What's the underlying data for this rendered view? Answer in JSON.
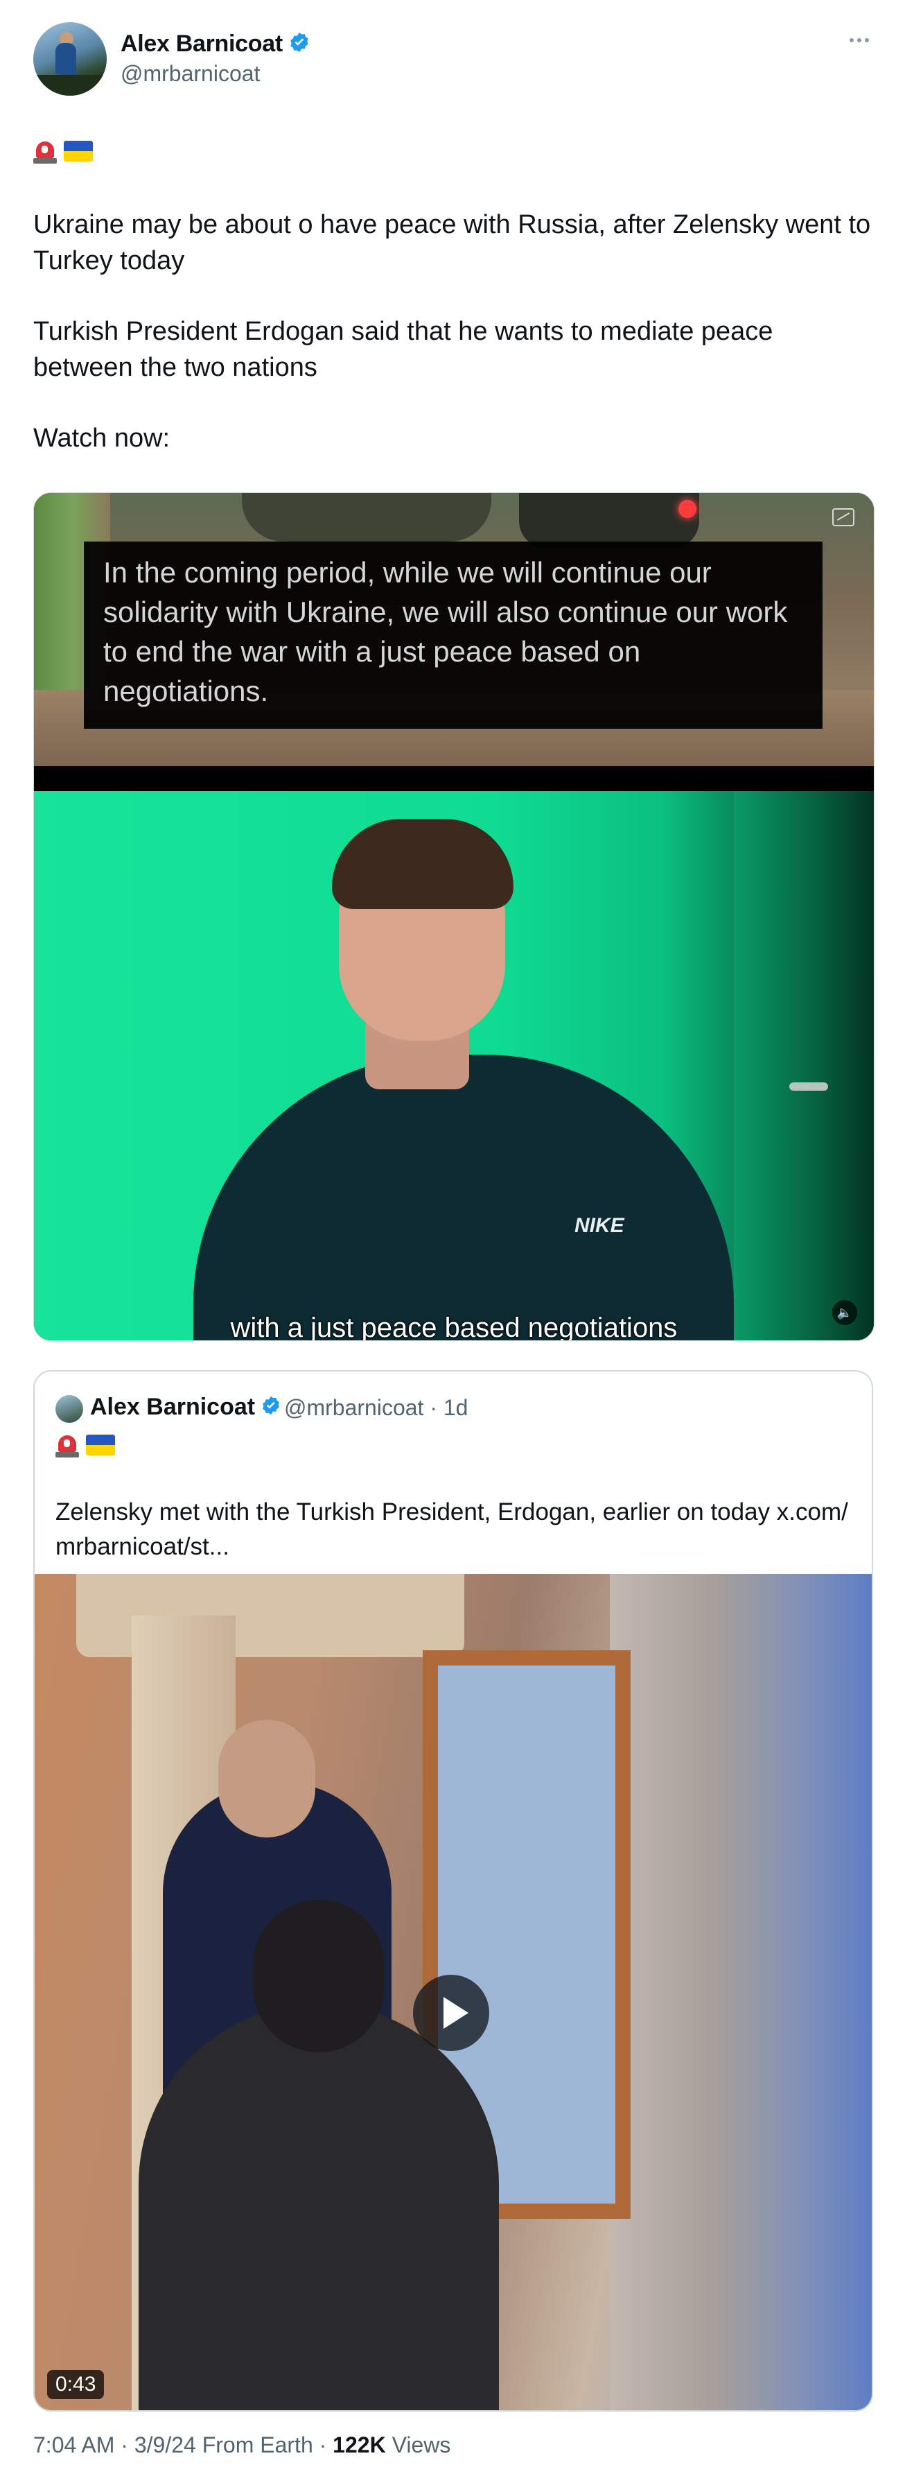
{
  "author": {
    "name": "Alex Barnicoat",
    "handle": "@mrbarnicoat",
    "verified": true
  },
  "tweet": {
    "emojis": [
      "siren",
      "ukraine-flag"
    ],
    "paragraphs": [
      "Ukraine may be about o have peace with Russia, after Zelensky went to Turkey today",
      "Turkish President Erdogan said that he wants to mediate peace between the two nations",
      "Watch now:"
    ]
  },
  "media": {
    "caption": "In the coming period, while we will continue our solidarity with Ukraine, we will also continue our work to end the war with a just peace based on negotiations.",
    "subtitle": "with a just peace based negotiations",
    "logo_text": "NIKE"
  },
  "quoted_tweet": {
    "author_name": "Alex Barnicoat",
    "handle_time": "@mrbarnicoat · 1d",
    "text": "Zelensky met with the Turkish President, Erdogan, earlier on today x.com/ mrbarnicoat/st...",
    "video_duration": "0:43"
  },
  "meta": {
    "time_date": "7:04 AM · 3/9/24 From Earth · ",
    "views_count": "122K",
    "views_label": " Views"
  },
  "colors": {
    "verified_blue": "#1d9bf0",
    "secondary_text": "#536471"
  }
}
